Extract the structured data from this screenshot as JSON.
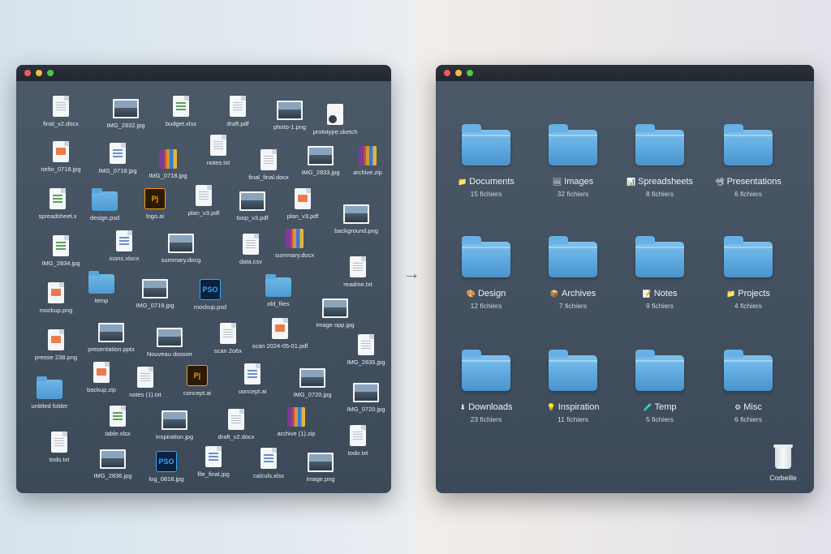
{
  "left_window": {
    "files": [
      {
        "label": "final_v2.docx",
        "kind": "doc-txt"
      },
      {
        "label": "IMG_2832.jpg",
        "kind": "image"
      },
      {
        "label": "budget.xlsx",
        "kind": "doc-sheet"
      },
      {
        "label": "draft.pdf",
        "kind": "doc-txt"
      },
      {
        "label": "photo-1.png",
        "kind": "image"
      },
      {
        "label": "prototype.sketch",
        "kind": "sketch"
      },
      {
        "label": "nefio_0718.jpg",
        "kind": "doc-pres"
      },
      {
        "label": "IMG_0718.jpg",
        "kind": "doc-blue"
      },
      {
        "label": "IMG_0718.jpg",
        "kind": "zip"
      },
      {
        "label": "notes.txt",
        "kind": "doc-txt"
      },
      {
        "label": "final_final.docx",
        "kind": "doc-txt"
      },
      {
        "label": "IMG_2833.jpg",
        "kind": "image"
      },
      {
        "label": "archive.zip",
        "kind": "zip"
      },
      {
        "label": "spreadsheet.x",
        "kind": "doc-sheet"
      },
      {
        "label": "design.psd",
        "kind": "folder"
      },
      {
        "label": "logo.ai",
        "kind": "ai"
      },
      {
        "label": "plan_v3.pdf",
        "kind": "doc-txt"
      },
      {
        "label": "toop_v3.pdf",
        "kind": "image"
      },
      {
        "label": "plan_v3.pdf",
        "kind": "doc-pres"
      },
      {
        "label": "background.png",
        "kind": "image"
      },
      {
        "label": "IMG_2834.jpg",
        "kind": "doc-sheet"
      },
      {
        "label": "icons.xlocx",
        "kind": "doc-blue"
      },
      {
        "label": "summary.docg",
        "kind": "image"
      },
      {
        "label": "data.csv",
        "kind": "doc-txt"
      },
      {
        "label": "summary.docx",
        "kind": "zip"
      },
      {
        "label": "readme.txt",
        "kind": "doc-txt"
      },
      {
        "label": "mockup.png",
        "kind": "doc-pres"
      },
      {
        "label": "temp",
        "kind": "folder"
      },
      {
        "label": "IMG_0719.jpg",
        "kind": "image"
      },
      {
        "label": "mockup.psd",
        "kind": "ps"
      },
      {
        "label": "old_files",
        "kind": "folder"
      },
      {
        "label": "image opp.jpg",
        "kind": "image"
      },
      {
        "label": "preose 238.png",
        "kind": "doc-pres"
      },
      {
        "label": "presentation.pptx",
        "kind": "image"
      },
      {
        "label": "Nouveau dossier",
        "kind": "image"
      },
      {
        "label": "scan 2o6x",
        "kind": "doc-txt"
      },
      {
        "label": "scan 2024-05-01.pdf",
        "kind": "doc-pres"
      },
      {
        "label": "IMG_2835.jpg",
        "kind": "doc-txt"
      },
      {
        "label": "backup.zip",
        "kind": "doc-pres"
      },
      {
        "label": "notes (1).txt",
        "kind": "doc-txt"
      },
      {
        "label": "concept.ai",
        "kind": "ai"
      },
      {
        "label": "uoncept.ai",
        "kind": "doc-blue"
      },
      {
        "label": "IMG_0720.jpg",
        "kind": "image"
      },
      {
        "label": "untitled folder",
        "kind": "folder"
      },
      {
        "label": "IMG_0720.jpg",
        "kind": "image"
      },
      {
        "label": "table.xlsx",
        "kind": "doc-sheet"
      },
      {
        "label": "inspiration.jpg",
        "kind": "image"
      },
      {
        "label": "draft_v2.docx",
        "kind": "doc-txt"
      },
      {
        "label": "archive (1).zip",
        "kind": "zip"
      },
      {
        "label": "todo.txt",
        "kind": "doc-txt"
      },
      {
        "label": "todo.txt",
        "kind": "doc-txt"
      },
      {
        "label": "IMG_2836.jpg",
        "kind": "image"
      },
      {
        "label": "log_0818.jpg",
        "kind": "ps"
      },
      {
        "label": "file_final.jpg",
        "kind": "doc-blue"
      },
      {
        "label": "calculs.xlsx",
        "kind": "doc-blue"
      },
      {
        "label": "image.png",
        "kind": "image"
      }
    ]
  },
  "arrow": "→",
  "right_window": {
    "folders": [
      {
        "name": "Documents",
        "emoji": "📁",
        "count": "15 fichiers"
      },
      {
        "name": "Images",
        "emoji": "🖼",
        "count": "32 fichiers"
      },
      {
        "name": "Spreadsheets",
        "emoji": "📊",
        "count": "8 fichiers"
      },
      {
        "name": "Presentations",
        "emoji": "📽",
        "count": "6 fichiers"
      },
      {
        "name": "Design",
        "emoji": "🎨",
        "count": "12 fichiers"
      },
      {
        "name": "Archives",
        "emoji": "📦",
        "count": "7 fichiers"
      },
      {
        "name": "Notes",
        "emoji": "📝",
        "count": "9 fichiers"
      },
      {
        "name": "Projects",
        "emoji": "📁",
        "count": "4 fichiers"
      },
      {
        "name": "Downloads",
        "emoji": "⬇",
        "count": "23 fichiers"
      },
      {
        "name": "Inspiration",
        "emoji": "💡",
        "count": "11 fichiers"
      },
      {
        "name": "Temp",
        "emoji": "🧪",
        "count": "5 fichiers"
      },
      {
        "name": "Misc",
        "emoji": "⚙",
        "count": "6 fichiers"
      }
    ],
    "trash_label": "Corbeille"
  },
  "icon_text": {
    "ps": "PSO",
    "ai": "Pj"
  }
}
